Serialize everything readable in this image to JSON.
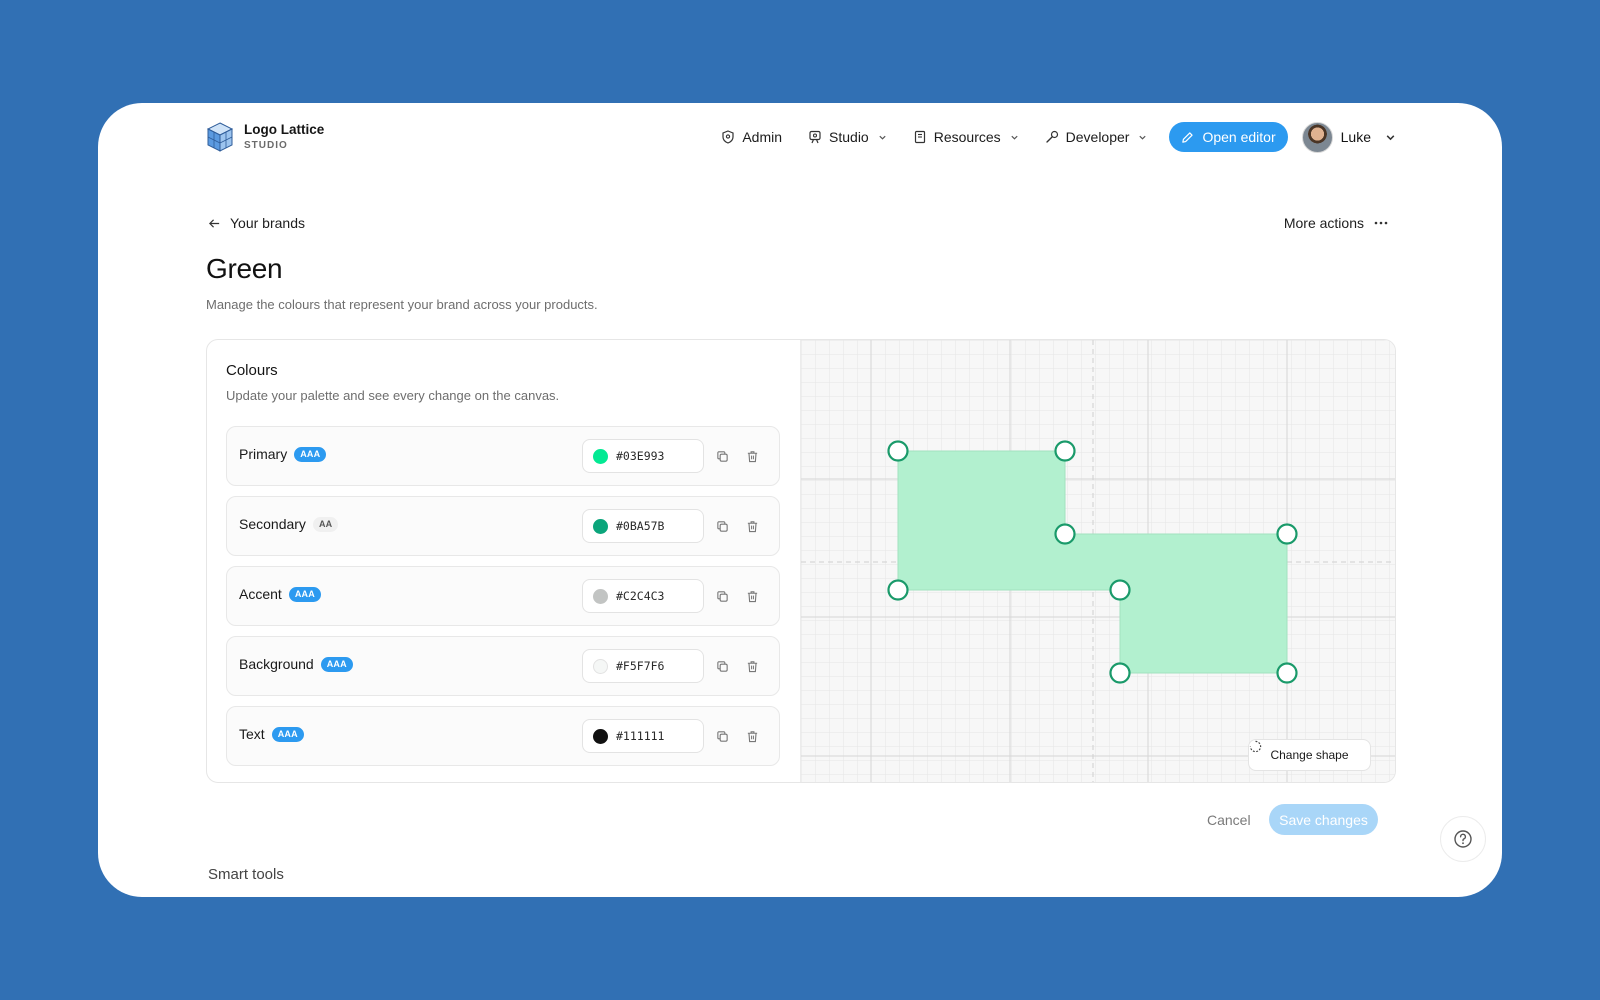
{
  "app": {
    "name": "Logo Lattice",
    "subtitle": "STUDIO"
  },
  "nav": {
    "admin": "Admin",
    "studio": "Studio",
    "resources": "Resources",
    "developer": "Developer",
    "open_editor": "Open editor",
    "user": "Luke"
  },
  "breadcrumb": {
    "back": "Your brands",
    "more_actions": "More actions"
  },
  "page": {
    "title": "Green",
    "subtitle": "Manage the colours that represent your brand across your products."
  },
  "colours": {
    "title": "Colours",
    "subtitle": "Update your palette and see every change on the canvas.",
    "items": [
      {
        "label": "Primary",
        "badge": "AAA",
        "hex": "#03E993",
        "color": "#03E993"
      },
      {
        "label": "Secondary",
        "badge": "AA",
        "hex": "#0BA57B",
        "color": "#0BA57B"
      },
      {
        "label": "Accent",
        "badge": "AAA",
        "hex": "#C2C4C3",
        "color": "#C2C4C3"
      },
      {
        "label": "Background",
        "badge": "AAA",
        "hex": "#F5F7F6",
        "color": "#F5F7F6"
      },
      {
        "label": "Text",
        "badge": "AAA",
        "hex": "#111111",
        "color": "#111111"
      }
    ]
  },
  "canvas": {
    "change_shape": "Change shape"
  },
  "actions": {
    "cancel": "Cancel",
    "save": "Save changes"
  },
  "next_section": "Smart tools",
  "colors": {
    "accent": "#2c9af0",
    "background": "#3170b4",
    "shape_fill": "#b2f0cf",
    "handle_stroke": "#1a9a6a"
  }
}
